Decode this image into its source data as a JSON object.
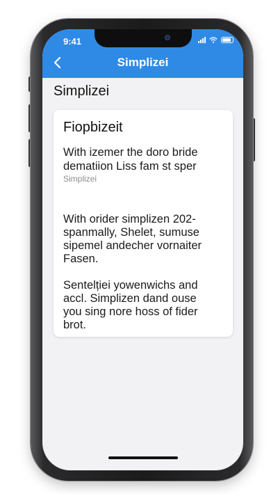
{
  "status_bar": {
    "time": "9:41",
    "icons": [
      "cellular-signal-icon",
      "wifi-icon",
      "battery-icon"
    ]
  },
  "nav_bar": {
    "title": "Simplizei",
    "back_icon": "chevron-left-icon",
    "background_color": "#2f8ae6"
  },
  "page": {
    "heading": "Simplizei"
  },
  "card": {
    "title": "Fiopbizeit",
    "intro_lines": [
      "With izemer the doro bride",
      "dematiion Liss fam st sper"
    ],
    "caption": "Simplizei",
    "paragraph_1": [
      "With orider simplizen 202-",
      "spanmally, Shelet, sumuse",
      "sipemel andecher vornaiter",
      "Fasen."
    ],
    "paragraph_2": [
      "Sentelției yowenwichs and",
      "accl. Simplizen dand ouse",
      "you sing nore hoss of fider",
      "brot."
    ]
  }
}
